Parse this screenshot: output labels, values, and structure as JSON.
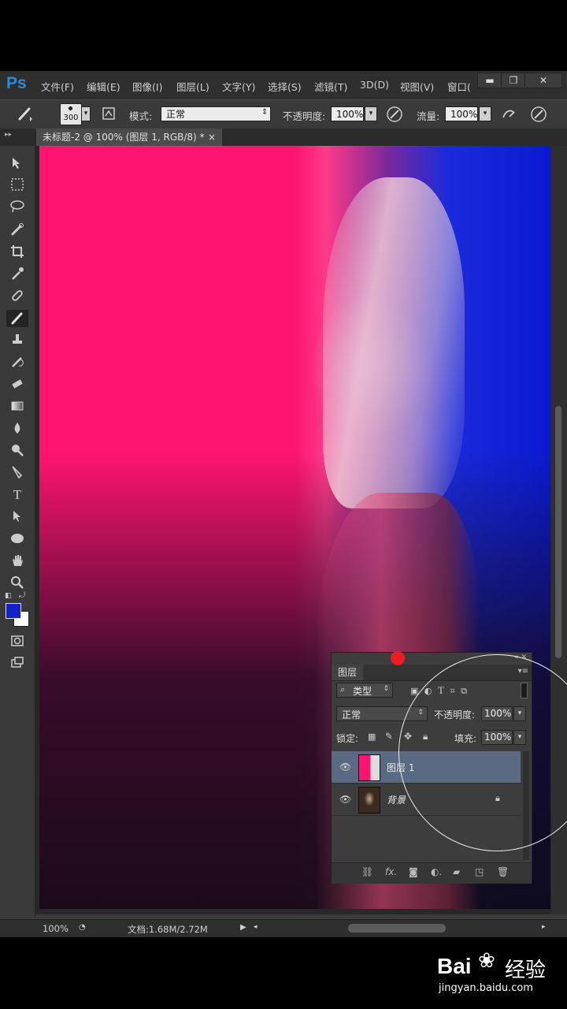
{
  "app": {
    "logo": "Ps",
    "menu": [
      "文件(F)",
      "编辑(E)",
      "图像(I)",
      "图层(L)",
      "文字(Y)",
      "选择(S)",
      "滤镜(T)",
      "3D(D)",
      "视图(V)",
      "窗口("
    ],
    "window_buttons": [
      "▬",
      "❐",
      "✕"
    ]
  },
  "options": {
    "brush_size": "300",
    "mode_label": "模式:",
    "mode_value": "正常",
    "opacity_label": "不透明度:",
    "opacity_value": "100%",
    "flow_label": "流量:",
    "flow_value": "100%"
  },
  "document": {
    "tab_title": "未标题-2 @ 100% (图层 1, RGB/8) *",
    "close": "×"
  },
  "status": {
    "zoom": "100%",
    "doc_info": "文档:1.68M/2.72M"
  },
  "layers_panel": {
    "tab": "图层",
    "filter_kind": "类型",
    "blend_mode": "正常",
    "opacity_label": "不透明度:",
    "opacity_value": "100%",
    "lock_label": "锁定:",
    "fill_label": "填充:",
    "fill_value": "100%",
    "layers": [
      {
        "name": "图层 1",
        "selected": true
      },
      {
        "name": "背景",
        "locked": true
      }
    ]
  },
  "watermark": {
    "brand": "Bai",
    "brand2": "经验",
    "url": "jingyan.baidu.com"
  },
  "colors": {
    "foreground": "#1022c8",
    "background": "#ffffff",
    "pink": "#ff1471",
    "blue": "#0a1ad0"
  }
}
